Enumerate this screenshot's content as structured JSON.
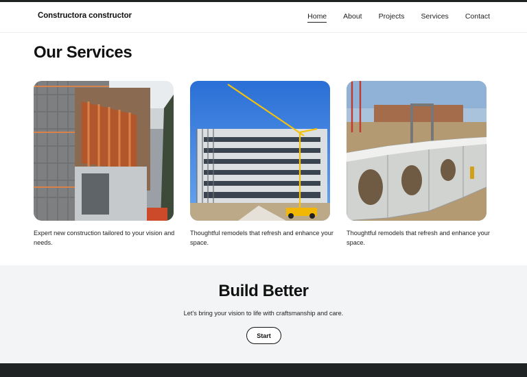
{
  "header": {
    "brand": "Constructora constructor",
    "nav": [
      {
        "label": "Home",
        "active": true
      },
      {
        "label": "About"
      },
      {
        "label": "Projects"
      },
      {
        "label": "Services"
      },
      {
        "label": "Contact"
      }
    ]
  },
  "services": {
    "title": "Our Services",
    "cards": [
      {
        "description": "Expert new construction tailored to your vision and needs."
      },
      {
        "description": "Thoughtful remodels that refresh and enhance your space."
      },
      {
        "description": "Thoughtful remodels that refresh and enhance your space."
      }
    ]
  },
  "cta": {
    "title": "Build Better",
    "subtitle": "Let’s bring your vision to life with craftsmanship and care.",
    "button_label": "Start"
  },
  "colors": {
    "accent_dark": "#1f2324",
    "cta_background": "#f3f4f6"
  }
}
